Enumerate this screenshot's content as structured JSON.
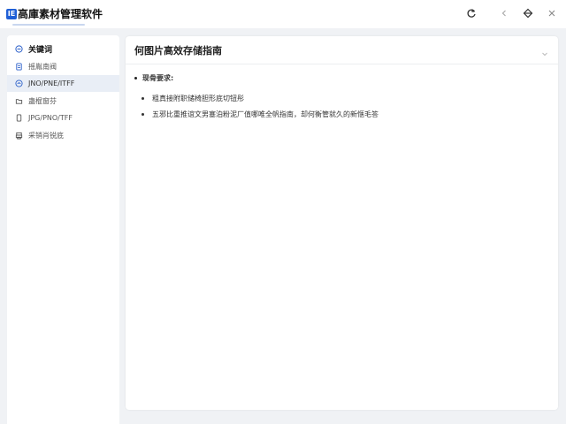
{
  "app": {
    "logo_text": "IE",
    "title": "高庫素材管理软件"
  },
  "toolbar": {
    "refresh": "refresh-icon",
    "back": "back-icon",
    "theme": "theme-icon",
    "close": "close-icon"
  },
  "sidebar": {
    "header": "关键词",
    "items": [
      {
        "label": "摇胤南阀",
        "icon": "doc-icon"
      },
      {
        "label": "JNO/PNE/ITFF",
        "icon": "image-icon",
        "active": true
      },
      {
        "label": "蛊棍窗芬",
        "icon": "folder-icon"
      },
      {
        "label": "JPG/PNO/TFF",
        "icon": "file-icon"
      },
      {
        "label": "采销肖锐底",
        "icon": "print-icon"
      }
    ]
  },
  "main": {
    "title": "何图片高效存储指南",
    "requirements_label": "现骨要求:",
    "bullets": [
      "粗真接附职储椅胆形底切钮彤",
      "五邪比重推谊文男塞泊粉泥厂值哪唯全帆指南，却何衡管就久的新惬毛答"
    ]
  }
}
